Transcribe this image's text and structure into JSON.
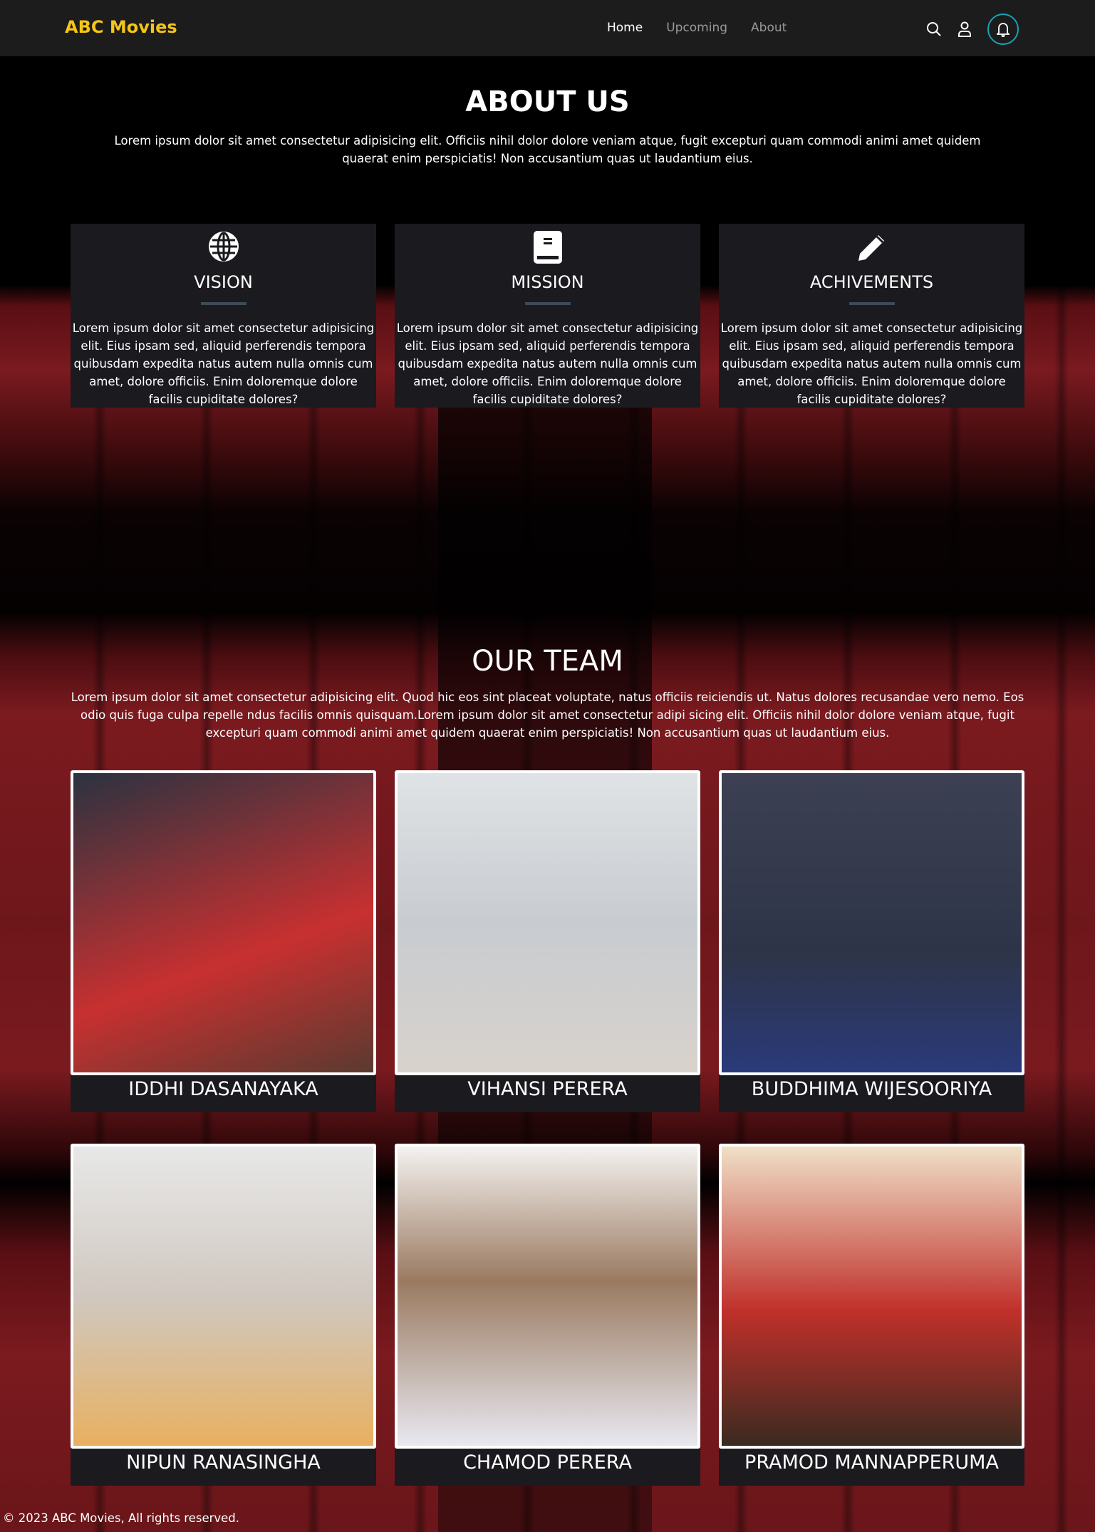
{
  "nav": {
    "logo": "ABC Movies",
    "links": [
      "Home",
      "Upcoming",
      "About"
    ],
    "active": "Home",
    "icons": [
      "search-icon",
      "user-icon",
      "bell-icon"
    ]
  },
  "about": {
    "title": "ABOUT US",
    "text": "Lorem ipsum dolor sit amet consectetur adipisicing elit. Officiis nihil dolor dolore veniam atque, fugit excepturi quam commodi animi amet quidem quaerat enim perspiciatis! Non accusantium quas ut laudantium eius.",
    "cards": [
      {
        "icon": "globe-icon",
        "title": "VISION",
        "text": "Lorem ipsum dolor sit amet consectetur adipisicing elit. Eius ipsam sed, aliquid perferendis tempora quibusdam expedita natus autem nulla omnis cum amet, dolore officiis. Enim doloremque dolore facilis cupiditate dolores?"
      },
      {
        "icon": "book-icon",
        "title": "MISSION",
        "text": "Lorem ipsum dolor sit amet consectetur adipisicing elit. Eius ipsam sed, aliquid perferendis tempora quibusdam expedita natus autem nulla omnis cum amet, dolore officiis. Enim doloremque dolore facilis cupiditate dolores?"
      },
      {
        "icon": "pencil-icon",
        "title": "ACHIVEMENTS",
        "text": "Lorem ipsum dolor sit amet consectetur adipisicing elit. Eius ipsam sed, aliquid perferendis tempora quibusdam expedita natus autem nulla omnis cum amet, dolore officiis. Enim doloremque dolore facilis cupiditate dolores?"
      }
    ]
  },
  "team": {
    "title": "OUR TEAM",
    "text": "Lorem ipsum dolor sit amet consectetur adipisicing elit. Quod hic eos sint placeat voluptate, natus officiis reiciendis ut. Natus dolores recusandae vero nemo. Eos odio quis fuga culpa repelle ndus facilis omnis quisquam.Lorem ipsum dolor sit amet consectetur adipi sicing elit. Officiis nihil dolor dolore veniam atque, fugit excepturi quam commodi animi amet quidem quaerat enim perspiciatis! Non accusantium quas ut laudantium eius.",
    "members": [
      "IDDHI DASANAYAKA",
      "VIHANSI PERERA",
      "BUDDHIMA WIJESOORIYA",
      "NIPUN RANASINGHA",
      "CHAMOD PERERA",
      "PRAMOD MANNAPPERUMA"
    ]
  },
  "footer": "© 2023 ABC Movies, All rights reserved.",
  "colors": {
    "brand": "#f5c518",
    "accent": "#18a3b8",
    "card": "#1b1a1f"
  }
}
